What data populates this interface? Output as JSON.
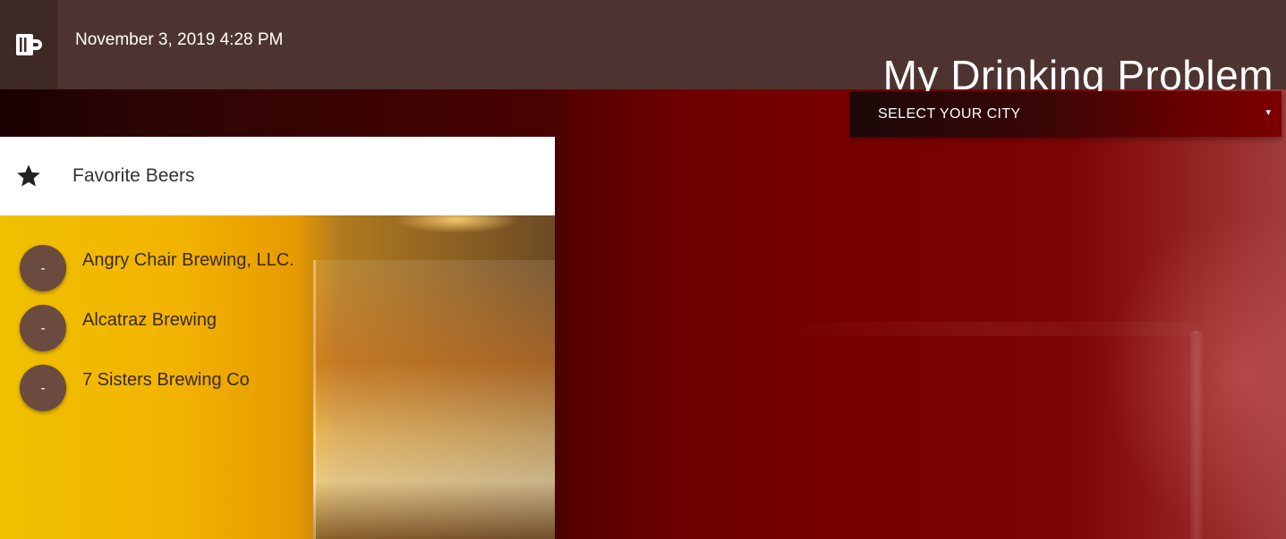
{
  "header": {
    "logo_icon": "beer-mug-icon",
    "datetime": "November 3, 2019 4:28 PM",
    "title": "My Drinking Problem"
  },
  "city_select": {
    "label": "SELECT YOUR CITY",
    "caret_icon": "caret-down-icon",
    "caret": "▾"
  },
  "favorites": {
    "icon": "star-icon",
    "title": "Favorite Beers",
    "remove_label": "-",
    "items": [
      {
        "name": "Angry Chair Brewing, LLC."
      },
      {
        "name": "Alcatraz Brewing"
      },
      {
        "name": "7 Sisters Brewing Co"
      }
    ]
  },
  "colors": {
    "header_bg": "#4e3430",
    "logo_bg": "#3f2925",
    "remove_button": "#6b4a3f",
    "background_red": "#7a0000",
    "panel_yellow": "#f2b300"
  }
}
